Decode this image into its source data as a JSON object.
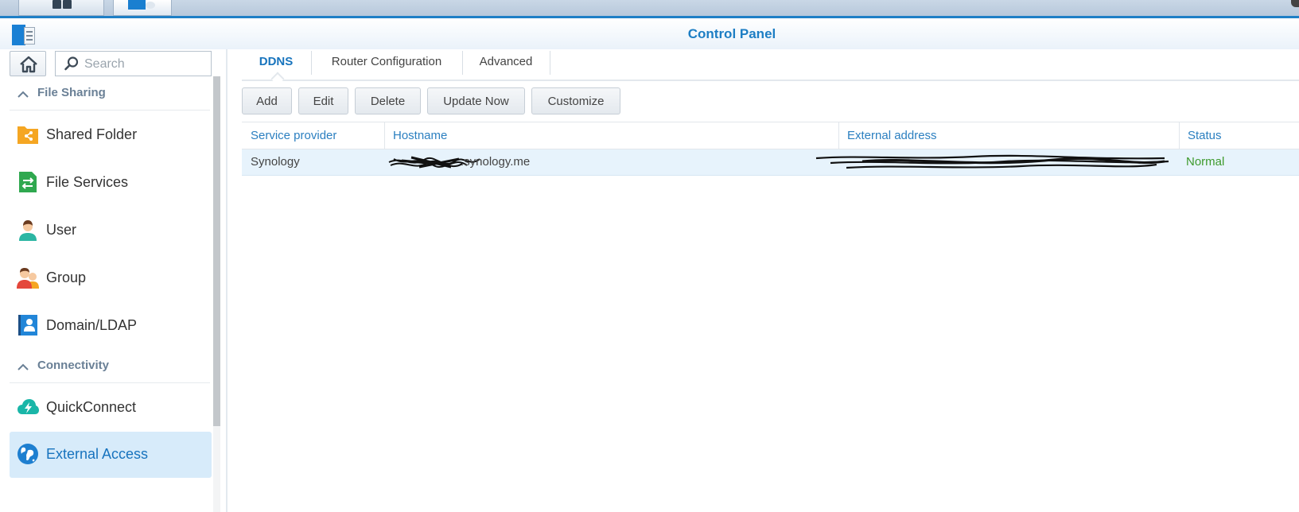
{
  "window": {
    "title": "Control Panel"
  },
  "taskbar": {
    "items": [
      "main-menu-icon",
      "control-panel-task-icon"
    ]
  },
  "sidebar": {
    "search": {
      "placeholder": "Search",
      "value": ""
    },
    "sections": [
      {
        "label": "File Sharing",
        "expanded": true
      },
      {
        "label": "Connectivity",
        "expanded": true
      }
    ],
    "items": [
      {
        "label": "Shared Folder",
        "icon": "shared-folder-icon"
      },
      {
        "label": "File Services",
        "icon": "file-services-icon"
      },
      {
        "label": "User",
        "icon": "user-icon"
      },
      {
        "label": "Group",
        "icon": "group-icon"
      },
      {
        "label": "Domain/LDAP",
        "icon": "domain-ldap-icon"
      },
      {
        "label": "QuickConnect",
        "icon": "quickconnect-icon"
      },
      {
        "label": "External Access",
        "icon": "globe-icon",
        "active": true
      }
    ]
  },
  "main": {
    "tabs": [
      {
        "label": "DDNS",
        "active": true
      },
      {
        "label": "Router Configuration"
      },
      {
        "label": "Advanced"
      }
    ],
    "toolbar": {
      "add": "Add",
      "edit": "Edit",
      "delete": "Delete",
      "update_now": "Update Now",
      "customize": "Customize"
    },
    "table": {
      "columns": [
        "Service provider",
        "Hostname",
        "External address",
        "Status"
      ],
      "rows": [
        {
          "provider": "Synology",
          "hostname_visible": ".synology.me",
          "status": "Normal"
        }
      ]
    }
  },
  "colors": {
    "accent": "#1e7fc6",
    "title": "#1d7ec4",
    "selected_bg": "#d7ebfa",
    "status_ok": "#3e9a2c"
  }
}
